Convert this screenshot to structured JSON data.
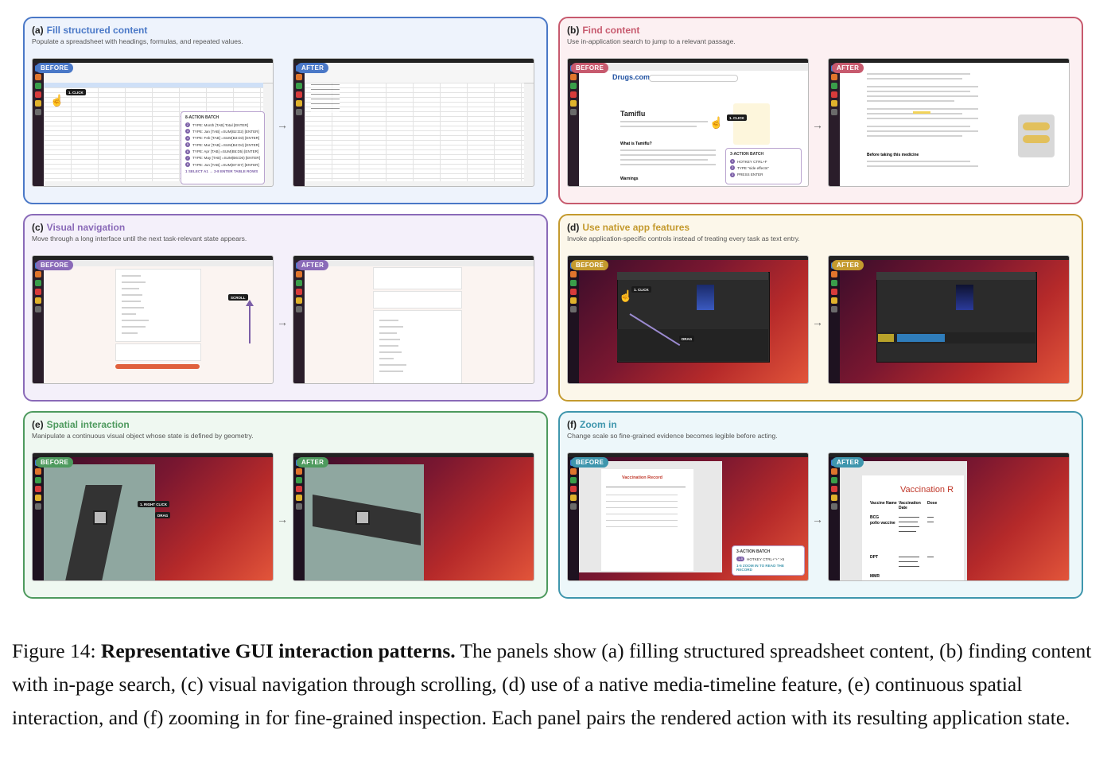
{
  "badges": {
    "before": "BEFORE",
    "after": "AFTER"
  },
  "arrow": "→",
  "panels": [
    {
      "letter": "(a)",
      "title": "Fill structured content",
      "subtitle": "Populate a spreadsheet with headings, formulas, and repeated values.",
      "color": "#4a78c7",
      "bg": "#eef3fc"
    },
    {
      "letter": "(b)",
      "title": "Find content",
      "subtitle": "Use in-application search to jump to a relevant passage.",
      "color": "#c75a6e",
      "bg": "#fcf0f2"
    },
    {
      "letter": "(c)",
      "title": "Visual navigation",
      "subtitle": "Move through a long interface until the next task-relevant state appears.",
      "color": "#8a6ab8",
      "bg": "#f4f0fa"
    },
    {
      "letter": "(d)",
      "title": "Use native app features",
      "subtitle": "Invoke application-specific controls instead of treating every task as text entry.",
      "color": "#c49a2e",
      "bg": "#fcf7ea"
    },
    {
      "letter": "(e)",
      "title": "Spatial interaction",
      "subtitle": "Manipulate a continuous visual object whose state is defined by geometry.",
      "color": "#4e9a5e",
      "bg": "#eff8f1"
    },
    {
      "letter": "(f)",
      "title": "Zoom in",
      "subtitle": "Change scale so fine-grained evidence becomes legible before acting.",
      "color": "#3f96ad",
      "bg": "#edf7fa"
    }
  ],
  "a": {
    "click": "1. CLICK",
    "batch_title": "8-ACTION BATCH",
    "batch_rows": [
      "TYPE: Month [TAB] Total [ENTER]",
      "TYPE: Jan [TAB] =SUM(B2:D2) [ENTER]",
      "TYPE: Feb [TAB] =SUM(B3:D3) [ENTER]",
      "TYPE: Mar [TAB] =SUM(B4:D4) [ENTER]",
      "TYPE: Apr [TAB] =SUM(B5:D5) [ENTER]",
      "TYPE: May [TAB] =SUM(B6:D6) [ENTER]",
      "TYPE: Jun [TAB] =SUM(B7:D7) [ENTER]"
    ],
    "batch_footer": "1 SELECT A1  →  2-8 ENTER TABLE ROWS"
  },
  "b": {
    "site": "Drugs.com",
    "drug": "Tamiflu",
    "heading": "What is Tamiflu?",
    "warnings": "Warnings",
    "before_taking": "Before taking this medicine",
    "click": "1. CLICK",
    "batch_title": "3-ACTION BATCH",
    "batch_rows": [
      "HOTKEY CTRL+F",
      "TYPE \"side effects\"",
      "PRESS ENTER"
    ]
  },
  "c": {
    "scroll": "SCROLL"
  },
  "d": {
    "click": "1. CLICK",
    "drag": "DRAG"
  },
  "e": {
    "right_click": "1. RIGHT CLICK",
    "drag": "DRAG"
  },
  "f": {
    "title_before": "Vaccination Record",
    "title_after": "Vaccination R",
    "headers": [
      "Vaccine Name",
      "Vaccination Date",
      "Dose"
    ],
    "rows": [
      [
        "BCG",
        "",
        ""
      ],
      [
        "polio vaccine",
        "",
        ""
      ],
      [
        "DPT",
        "",
        ""
      ],
      [
        "MMR",
        "",
        ""
      ]
    ],
    "batch_title": "3-ACTION BATCH",
    "batch_row": "HOTKEY CTRL+\"+\" ×5",
    "batch_footer": "1-5 ZOOM IN TO READ THE RECORD"
  },
  "caption": {
    "label": "Figure 14: ",
    "bold": "Representative GUI interaction patterns.",
    "text": " The panels show (a) filling structured spreadsheet content, (b) finding content with in-page search, (c) visual navigation through scrolling, (d) use of a native media-timeline feature, (e) continuous spatial interaction, and (f) zooming in for fine-grained inspection. Each panel pairs the rendered action with its resulting application state."
  }
}
